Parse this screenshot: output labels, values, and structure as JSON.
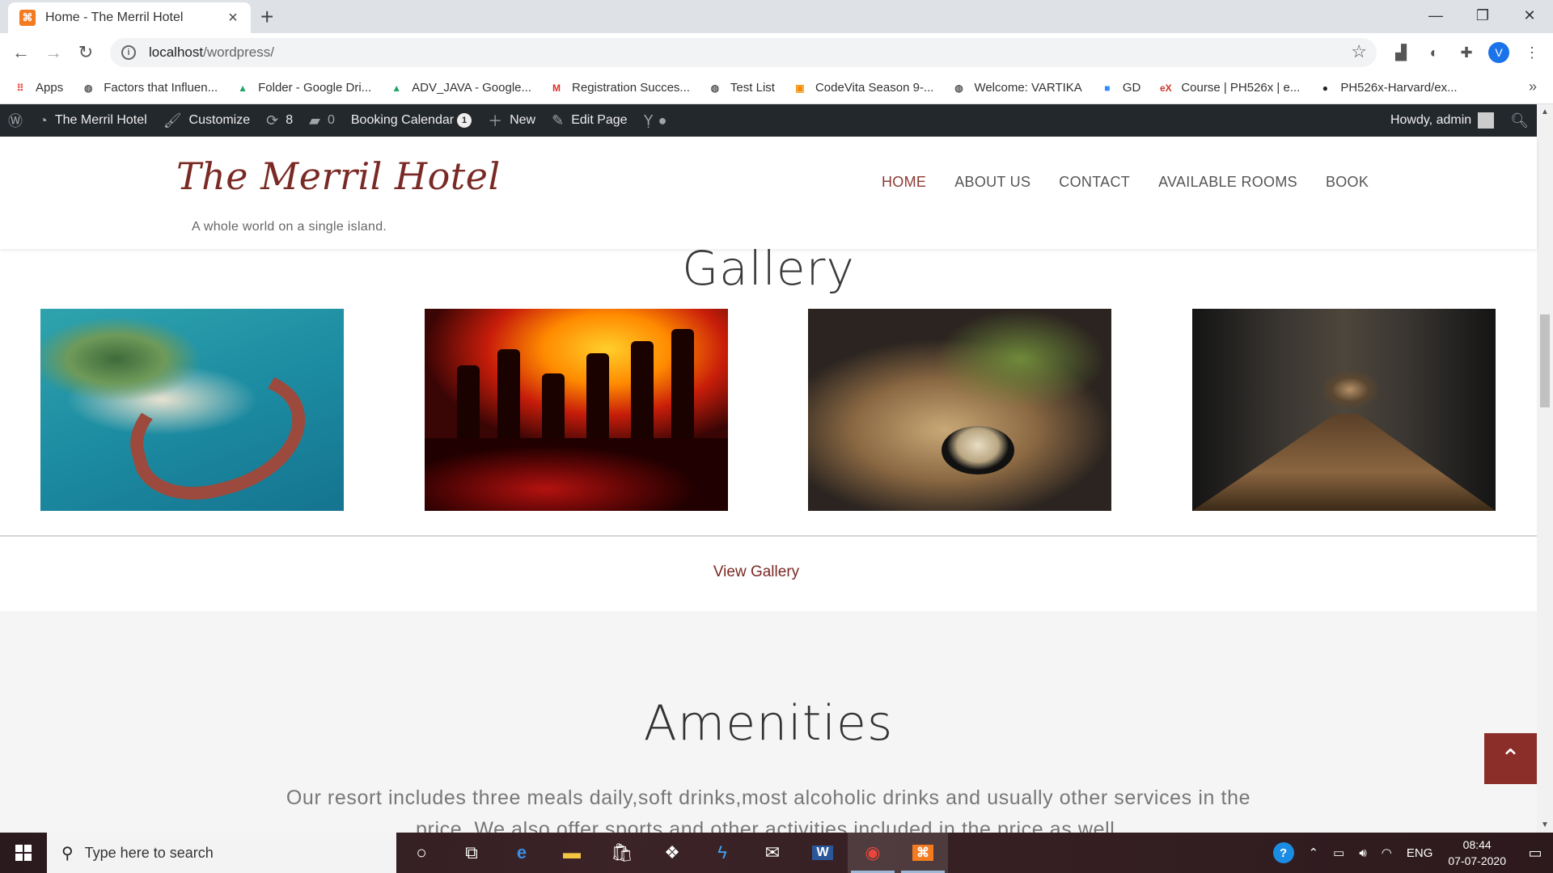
{
  "browser": {
    "tab_title": "Home - The Merril Hotel",
    "new_tab": "+",
    "url_host": "localhost",
    "url_path": "/wordpress/",
    "profile_initial": "V",
    "bookmarks": [
      {
        "label": "Apps",
        "icon": "apps-grid-icon",
        "color": "#e8453c"
      },
      {
        "label": "Factors that Influen...",
        "icon": "globe-icon",
        "color": "#555555"
      },
      {
        "label": "Folder - Google Dri...",
        "icon": "google-drive-icon",
        "color": "#1fa463"
      },
      {
        "label": "ADV_JAVA - Google...",
        "icon": "google-drive-icon",
        "color": "#1fa463"
      },
      {
        "label": "Registration Succes...",
        "icon": "gmail-icon",
        "color": "#d93025"
      },
      {
        "label": "Test List",
        "icon": "globe-icon",
        "color": "#555555"
      },
      {
        "label": "CodeVita Season 9-...",
        "icon": "codevita-icon",
        "color": "#f28b00"
      },
      {
        "label": "Welcome: VARTIKA",
        "icon": "globe-icon",
        "color": "#555555"
      },
      {
        "label": "GD",
        "icon": "zoom-icon",
        "color": "#2d8cff"
      },
      {
        "label": "Course | PH526x | e...",
        "icon": "edx-icon",
        "color": "#d23228"
      },
      {
        "label": "PH526x-Harvard/ex...",
        "icon": "github-icon",
        "color": "#222222"
      }
    ]
  },
  "adminbar": {
    "site_name": "The Merril Hotel",
    "customize": "Customize",
    "updates_count": "8",
    "comments_count": "0",
    "booking_calendar": "Booking Calendar",
    "booking_badge": "1",
    "new": "New",
    "edit_page": "Edit Page",
    "howdy": "Howdy, admin"
  },
  "site": {
    "title": "The Merril Hotel",
    "tagline": "A whole world on a single island.",
    "nav": [
      "HOME",
      "ABOUT US",
      "CONTACT",
      "AVAILABLE ROOMS",
      "BOOK"
    ],
    "accent_color": "#7a2a25"
  },
  "gallery": {
    "title": "Gallery",
    "images": [
      "island-resort-image",
      "bar-bottles-image",
      "food-plate-image",
      "hotel-corridor-image"
    ],
    "view_link": "View Gallery"
  },
  "amenities": {
    "title": "Amenities",
    "text": "Our resort includes three meals daily,soft drinks,most alcoholic drinks and usually other services in the price. We also offer sports and other activities included in the price as well."
  },
  "taskbar": {
    "search_placeholder": "Type here to search",
    "language": "ENG",
    "time": "08:44",
    "date": "07-07-2020"
  }
}
